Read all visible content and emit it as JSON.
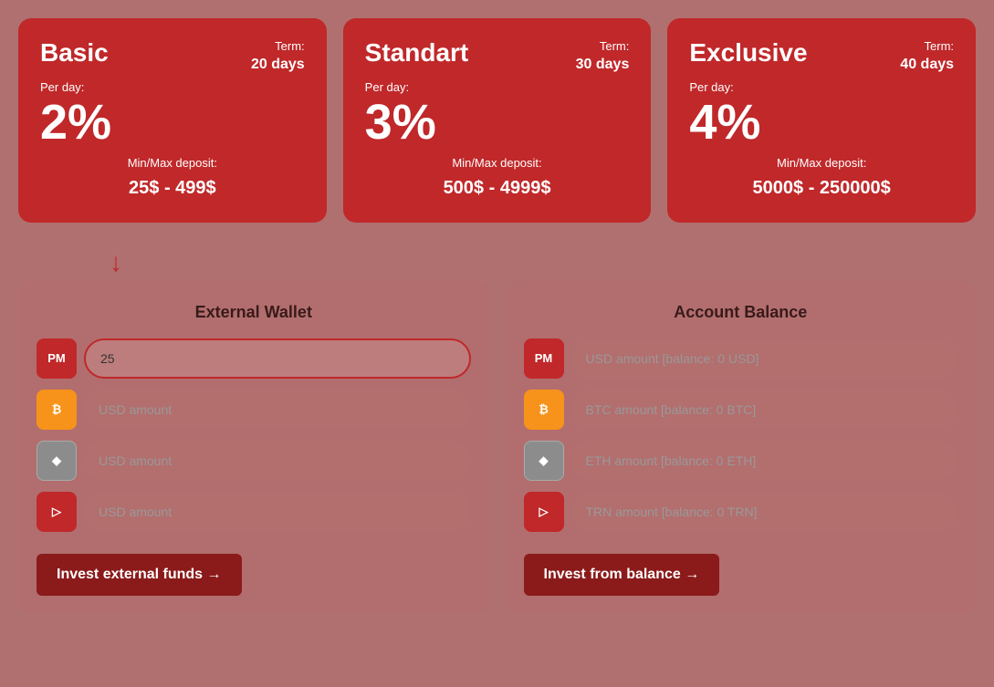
{
  "plans": [
    {
      "id": "basic",
      "title": "Basic",
      "term_label": "Term:",
      "term_value": "20 days",
      "perday_label": "Per day:",
      "percent": "2%",
      "minmax_label": "Min/Max deposit:",
      "minmax_value": "25$ - 499$"
    },
    {
      "id": "standart",
      "title": "Standart",
      "term_label": "Term:",
      "term_value": "30 days",
      "perday_label": "Per day:",
      "percent": "3%",
      "minmax_label": "Min/Max deposit:",
      "minmax_value": "500$ - 4999$"
    },
    {
      "id": "exclusive",
      "title": "Exclusive",
      "term_label": "Term:",
      "term_value": "40 days",
      "perday_label": "Per day:",
      "percent": "4%",
      "minmax_label": "Min/Max deposit:",
      "minmax_value": "5000$ - 250000$"
    }
  ],
  "external_wallet": {
    "title": "External Wallet",
    "inputs": [
      {
        "id": "pm",
        "badge": "PM",
        "badge_class": "badge-pm",
        "placeholder": "",
        "value": "25",
        "type": "text"
      },
      {
        "id": "btc",
        "badge": "₿",
        "badge_class": "badge-btc",
        "placeholder": "USD amount",
        "value": "",
        "type": "text"
      },
      {
        "id": "eth",
        "badge": "◆",
        "badge_class": "badge-eth",
        "placeholder": "USD amount",
        "value": "",
        "type": "text"
      },
      {
        "id": "trn",
        "badge": "▷",
        "badge_class": "badge-trn",
        "placeholder": "USD amount",
        "value": "",
        "type": "text"
      }
    ],
    "button_label": "Invest external funds →"
  },
  "account_balance": {
    "title": "Account Balance",
    "inputs": [
      {
        "id": "pm",
        "badge": "PM",
        "badge_class": "badge-pm",
        "placeholder": "USD amount [balance: 0 USD]",
        "value": ""
      },
      {
        "id": "btc",
        "badge": "₿",
        "badge_class": "badge-btc",
        "placeholder": "BTC amount [balance: 0 BTC]",
        "value": ""
      },
      {
        "id": "eth",
        "badge": "◆",
        "badge_class": "badge-eth",
        "placeholder": "ETH amount [balance: 0 ETH]",
        "value": ""
      },
      {
        "id": "trn",
        "badge": "▷",
        "badge_class": "badge-trn",
        "placeholder": "TRN amount [balance: 0 TRN]",
        "value": ""
      }
    ],
    "button_label": "Invest from balance →"
  }
}
